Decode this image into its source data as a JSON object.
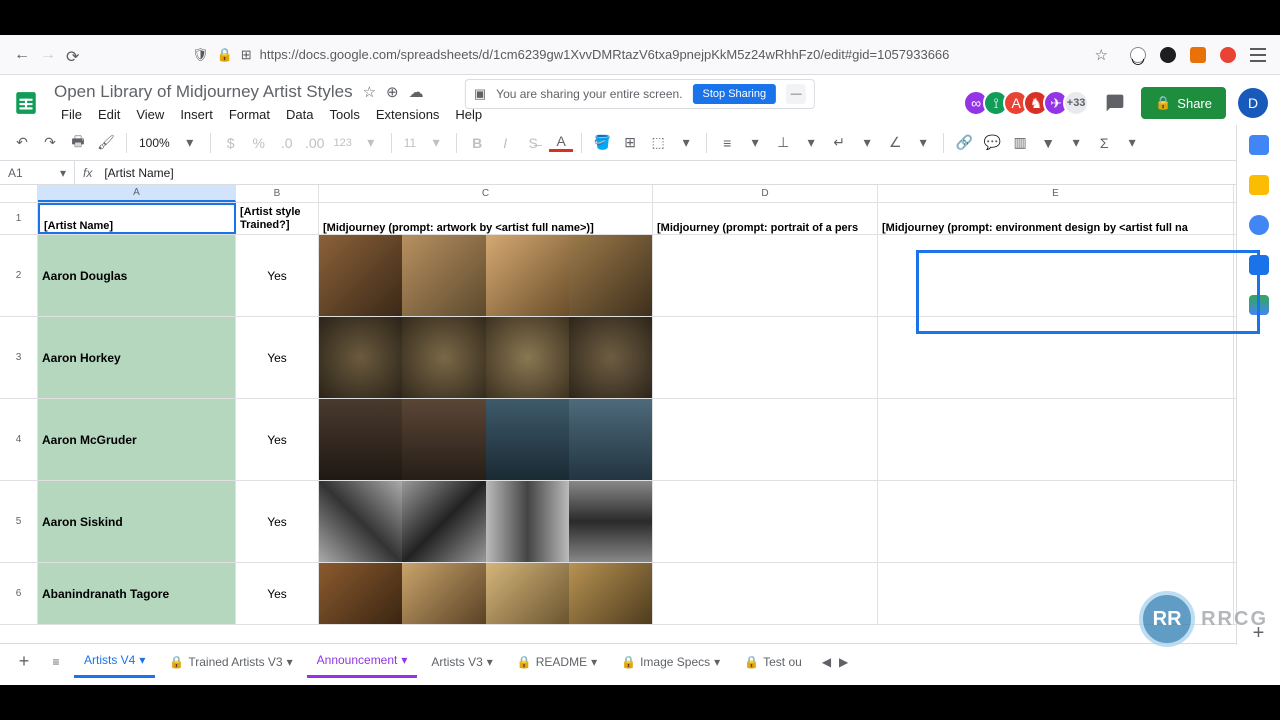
{
  "browser": {
    "url": "https://docs.google.com/spreadsheets/d/1cm6239gw1XvvDMRtazV6txa9pnejpKkM5z24wRhhFz0/edit#gid=1057933666"
  },
  "doc": {
    "title": "Open Library of Midjourney Artist Styles"
  },
  "menu": {
    "file": "File",
    "edit": "Edit",
    "view": "View",
    "insert": "Insert",
    "format": "Format",
    "data": "Data",
    "tools": "Tools",
    "extensions": "Extensions",
    "help": "Help"
  },
  "share_notice": {
    "text": "You are sharing your entire screen.",
    "stop": "Stop Sharing",
    "hide": "—"
  },
  "header_right": {
    "more_avatars": "+33",
    "share": "Share",
    "profile_initial": "D"
  },
  "toolbar": {
    "zoom": "100%",
    "font_size": "11",
    "currency_fmt": "123"
  },
  "formula": {
    "cell_ref": "A1",
    "fx": "fx",
    "value": "[Artist Name]"
  },
  "columns": {
    "a": "A",
    "b": "B",
    "c": "C",
    "d": "D",
    "e": "E"
  },
  "headers": {
    "a": "[Artist Name]",
    "b": "[Artist style Trained?]",
    "c": "[Midjourney (prompt: artwork by <artist full name>)]",
    "d": "[Midjourney (prompt: portrait of a pers",
    "e": "[Midjourney (prompt: environment design by <artist full na"
  },
  "rows": [
    {
      "n": "2",
      "name": "Aaron Douglas",
      "trained": "Yes"
    },
    {
      "n": "3",
      "name": "Aaron Horkey",
      "trained": "Yes"
    },
    {
      "n": "4",
      "name": "Aaron McGruder",
      "trained": "Yes"
    },
    {
      "n": "5",
      "name": "Aaron Siskind",
      "trained": "Yes"
    },
    {
      "n": "6",
      "name": "Abanindranath Tagore",
      "trained": "Yes"
    }
  ],
  "tabs": {
    "add": "+",
    "active": "Artists V4",
    "t2": "Trained Artists V3",
    "t3": "Announcement",
    "t4": "Artists V3",
    "t5": "README",
    "t6": "Image Specs",
    "t7": "Test ou"
  },
  "watermark": {
    "logo": "RR",
    "text": "RRCG"
  }
}
